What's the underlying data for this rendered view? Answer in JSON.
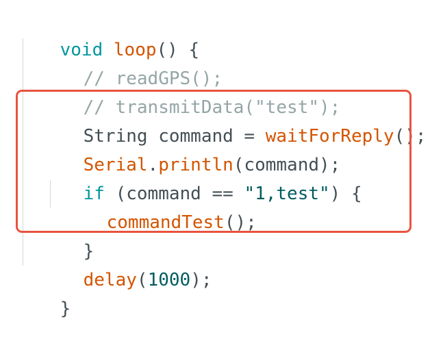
{
  "code": {
    "line1": {
      "kw": "void",
      "fn": "loop",
      "rest": "() {"
    },
    "line2": {
      "comment": "// readGPS();"
    },
    "line3": {
      "comment": "// transmitData(\"test\");"
    },
    "line4": {
      "type": "String",
      "var": " command = ",
      "fn": "waitForReply",
      "rest": "();"
    },
    "line5": {
      "obj": "Serial",
      "dot": ".",
      "fn": "println",
      "rest": "(command);"
    },
    "line6": {
      "kw": "if",
      "mid": " (command == ",
      "str": "\"1,test\"",
      "rest": ") {"
    },
    "line7": {
      "fn": "commandTest",
      "rest": "();"
    },
    "line8": {
      "brace": "}"
    },
    "line9": {
      "fn": "delay",
      "open": "(",
      "num": "1000",
      "close": ");"
    },
    "line10": {
      "brace": "}"
    }
  },
  "highlight_color": "#e8533f"
}
